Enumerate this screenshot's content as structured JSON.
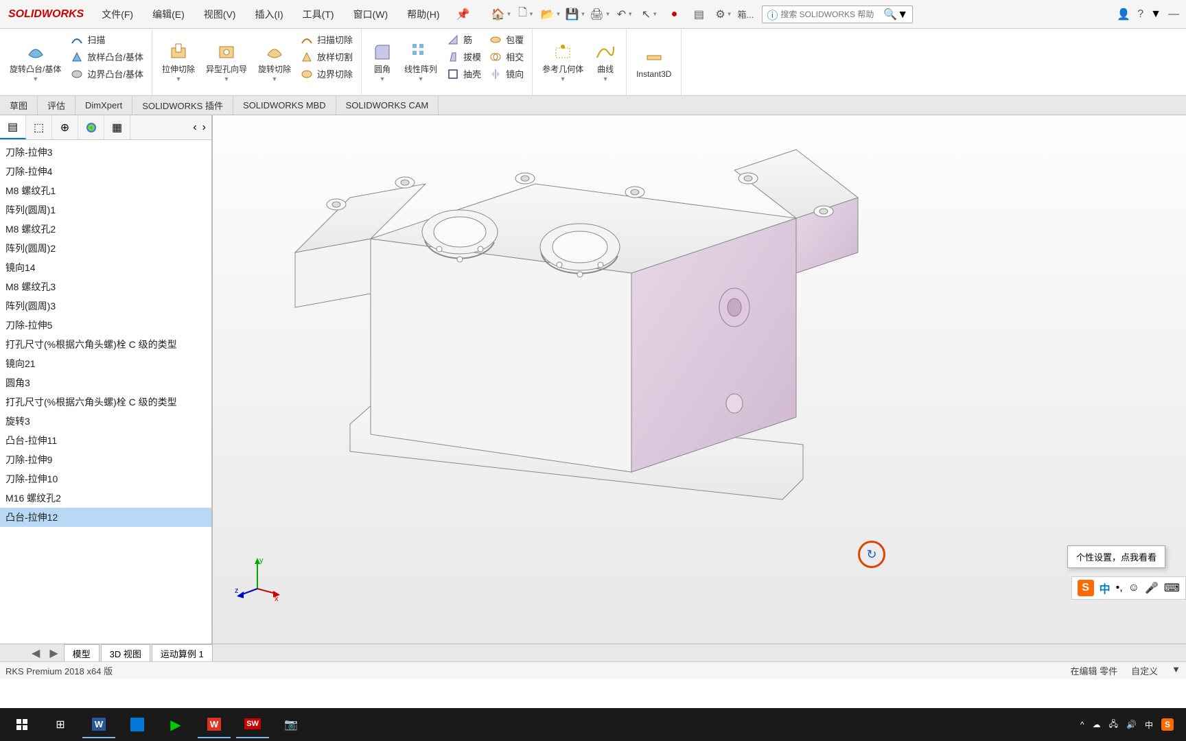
{
  "app": {
    "logo": "SOLIDWORKS"
  },
  "menu": {
    "file": "文件(F)",
    "edit": "编辑(E)",
    "view": "视图(V)",
    "insert": "插入(I)",
    "tools": "工具(T)",
    "window": "窗口(W)",
    "help": "帮助(H)",
    "box_label": "箱..."
  },
  "search": {
    "placeholder": "搜索 SOLIDWORKS 帮助"
  },
  "ribbon": {
    "features": {
      "revolve_boss": "旋转凸台/基体",
      "sweep": "扫描",
      "loft_boss": "放样凸台/基体",
      "boundary_boss": "边界凸台/基体",
      "extrude_cut": "拉伸切除",
      "hole_wizard": "异型孔向导",
      "revolve_cut": "旋转切除",
      "sweep_cut": "扫描切除",
      "loft_cut": "放样切割",
      "boundary_cut": "边界切除",
      "fillet": "圆角",
      "linear_pattern": "线性阵列",
      "rib": "筋",
      "draft": "拔模",
      "shell": "抽壳",
      "wrap": "包覆",
      "intersect": "相交",
      "mirror": "镜向",
      "ref_geom": "参考几何体",
      "curves": "曲线",
      "instant3d": "Instant3D"
    }
  },
  "tabs": {
    "sketch": "草图",
    "evaluate": "评估",
    "dimxpert": "DimXpert",
    "sw_addins": "SOLIDWORKS 插件",
    "sw_mbd": "SOLIDWORKS MBD",
    "sw_cam": "SOLIDWORKS CAM"
  },
  "tree": {
    "items": [
      "刀除-拉伸3",
      "刀除-拉伸4",
      "M8 螺纹孔1",
      "阵列(圆周)1",
      "M8 螺纹孔2",
      "阵列(圆周)2",
      "镜向14",
      "M8 螺纹孔3",
      "阵列(圆周)3",
      "刀除-拉伸5",
      "打孔尺寸(%根据六角头螺)栓 C 级的类型",
      "镜向21",
      "圆角3",
      "打孔尺寸(%根据六角头螺)栓 C 级的类型",
      "旋转3",
      "凸台-拉伸11",
      "刀除-拉伸9",
      "刀除-拉伸10",
      "M16 螺纹孔2",
      "凸台-拉伸12"
    ],
    "selected_index": 19
  },
  "bottom_tabs": {
    "model": "模型",
    "view3d": "3D 视图",
    "motion1": "运动算例 1"
  },
  "status": {
    "version": "RKS Premium 2018 x64 版",
    "editing": "在编辑 零件",
    "custom": "自定义"
  },
  "popup": {
    "text": "个性设置，点我看看"
  },
  "ime": {
    "lang": "中"
  },
  "triad": {
    "x": "x",
    "y": "y",
    "z": "z"
  },
  "tray": {
    "ime1": "中",
    "up": "^"
  }
}
